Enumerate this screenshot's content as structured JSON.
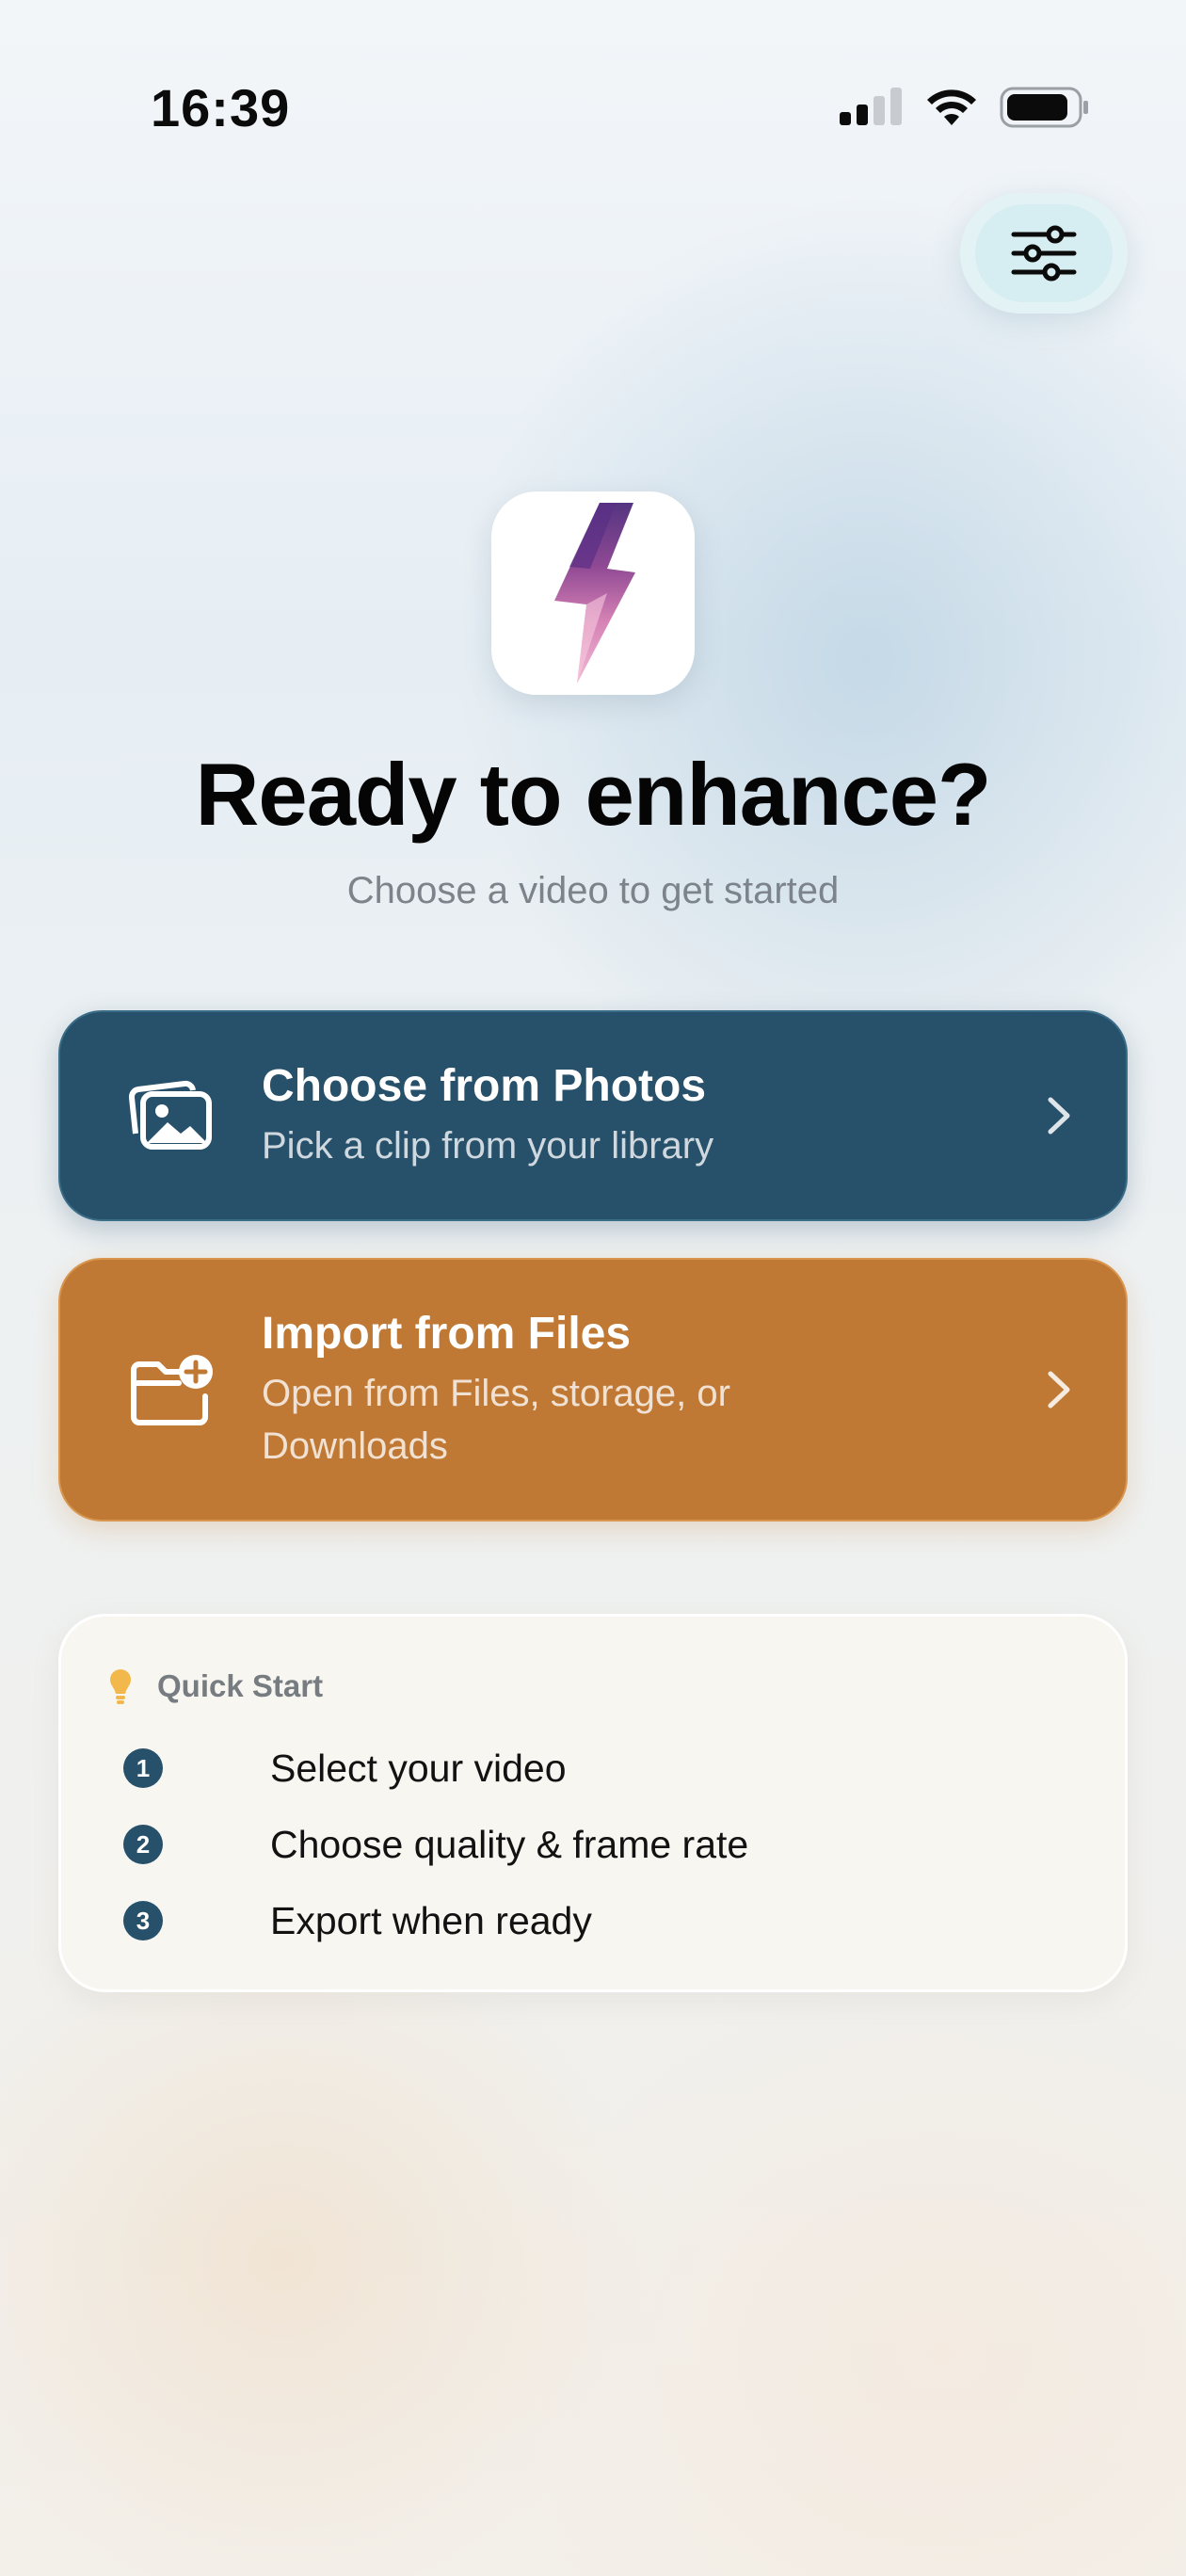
{
  "status_bar": {
    "time": "16:39",
    "icons": [
      "cellular-signal-icon",
      "wifi-icon",
      "battery-icon"
    ]
  },
  "header": {
    "settings_icon": "sliders-icon"
  },
  "hero": {
    "title": "Ready to enhance?",
    "subtitle": "Choose a video to get started"
  },
  "actions": [
    {
      "title": "Choose from Photos",
      "subtitle": "Pick a clip from your library",
      "icon": "photos-icon",
      "color": "#27506a"
    },
    {
      "title": "Import from Files",
      "subtitle": "Open from Files, storage, or Downloads",
      "icon": "folder-add-icon",
      "color": "#bf7934"
    }
  ],
  "quick_start": {
    "title": "Quick Start",
    "icon": "lightbulb-icon",
    "steps": [
      {
        "num": "1",
        "label": "Select your video"
      },
      {
        "num": "2",
        "label": "Choose quality & frame rate"
      },
      {
        "num": "3",
        "label": "Export when ready"
      }
    ]
  },
  "colors": {
    "accent_blue": "#27506a",
    "accent_orange": "#bf7934",
    "bulb": "#f2b84b"
  }
}
